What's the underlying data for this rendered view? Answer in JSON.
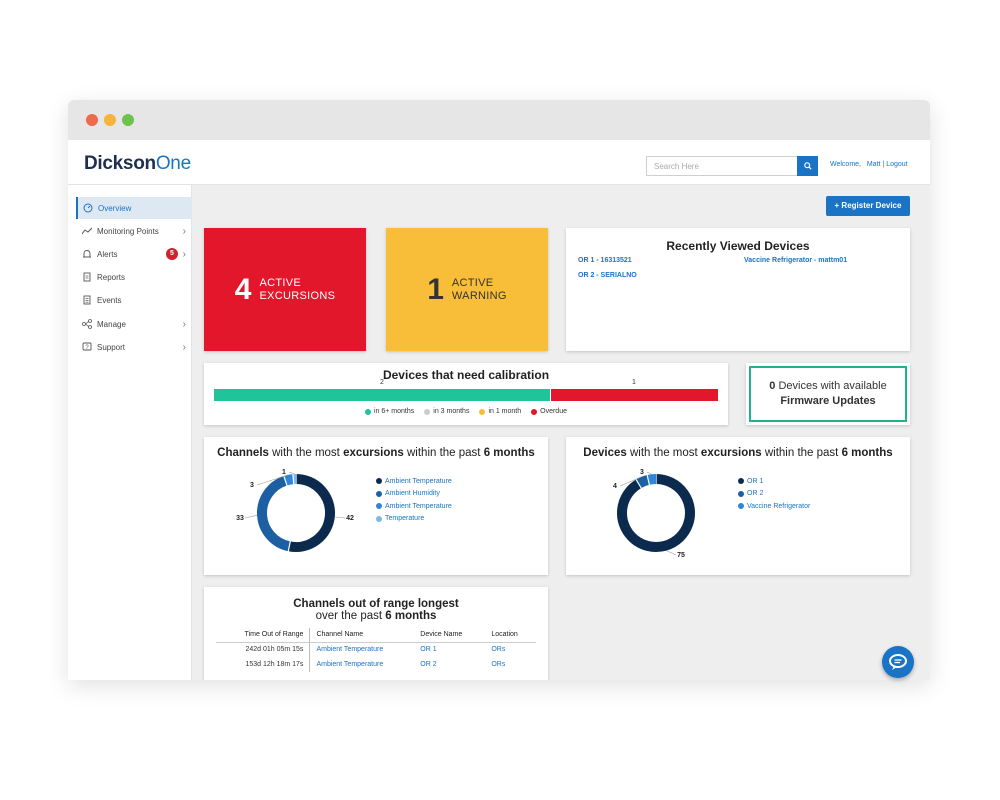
{
  "colors": {
    "primary": "#1a73c4",
    "danger": "#e2172b",
    "warning": "#f8be3a",
    "teal": "#1fc49a",
    "navy": "#0b2a4e"
  },
  "header": {
    "logo_main": "Dickson",
    "logo_accent": "One",
    "search_placeholder": "Search Here",
    "search_icon": "search-icon",
    "welcome": "Welcome,",
    "user": "Matt",
    "separator": "|",
    "logout": "Logout"
  },
  "sidebar": {
    "items": [
      {
        "label": "Overview",
        "icon": "gauge-icon"
      },
      {
        "label": "Monitoring Points",
        "icon": "trend-icon"
      },
      {
        "label": "Alerts",
        "icon": "bell-icon",
        "badge": "5"
      },
      {
        "label": "Reports",
        "icon": "report-icon"
      },
      {
        "label": "Events",
        "icon": "events-icon"
      },
      {
        "label": "Manage",
        "icon": "manage-icon"
      },
      {
        "label": "Support",
        "icon": "support-icon"
      }
    ]
  },
  "main": {
    "register_button": "+ Register Device",
    "excursions": {
      "count": "4",
      "line1": "ACTIVE",
      "line2": "EXCURSIONS"
    },
    "warnings": {
      "count": "1",
      "line1": "ACTIVE",
      "line2": "WARNING"
    },
    "recent": {
      "title": "Recently Viewed Devices",
      "links": [
        "OR 1 - 16313521",
        "Vaccine Refrigerator - mattm01",
        "OR 2 - SERIALNO"
      ]
    },
    "calibration": {
      "title": "Devices that need calibration",
      "segments": [
        {
          "label": "2",
          "value": 2,
          "color": "#1fc49a"
        },
        {
          "label": "1",
          "value": 1,
          "color": "#e2172b"
        }
      ],
      "legend": [
        {
          "label": "in 6+ months",
          "color": "#1fc49a"
        },
        {
          "label": "in 3 months",
          "color": "#cccccc"
        },
        {
          "label": "in 1 month",
          "color": "#f8be3a"
        },
        {
          "label": "Overdue",
          "color": "#e2172b"
        }
      ]
    },
    "firmware": {
      "count": "0",
      "line1": "Devices with available",
      "line2": "Firmware Updates"
    },
    "table": {
      "title_line1": "Channels out of range longest",
      "title_line2_prefix": "over the past ",
      "title_line2_bold": "6 months",
      "headers": [
        "Time Out of Range",
        "Channel Name",
        "Device Name",
        "Location"
      ],
      "rows": [
        [
          "242d 01h 05m 15s",
          "Ambient Temperature",
          "OR 1",
          "ORs"
        ],
        [
          "153d 12h 18m 17s",
          "Ambient Temperature",
          "OR 2",
          "ORs"
        ]
      ]
    }
  },
  "chart_data": [
    {
      "type": "pie",
      "title": "Channels with the most excursions within the past 6 months",
      "title_parts": [
        "Channels",
        " with the most ",
        "excursions",
        " within the past ",
        "6 months"
      ],
      "categories": [
        "Ambient Temperature",
        "Ambient Humidity",
        "Ambient Temperature",
        "Temperature"
      ],
      "values": [
        42,
        33,
        3,
        1
      ],
      "colors": [
        "#0b2a4e",
        "#1d5fa3",
        "#2f86d6",
        "#7ab8ea"
      ],
      "legend": "right"
    },
    {
      "type": "pie",
      "title": "Devices with the most excursions within the past 6 months",
      "title_parts": [
        "Devices",
        " with the most ",
        "excursions",
        " within the past ",
        "6 months"
      ],
      "categories": [
        "OR 1",
        "OR 2",
        "Vaccine Refrigerator"
      ],
      "values": [
        75,
        4,
        3
      ],
      "colors": [
        "#0b2a4e",
        "#1d5fa3",
        "#2f86d6"
      ],
      "legend": "right"
    }
  ]
}
